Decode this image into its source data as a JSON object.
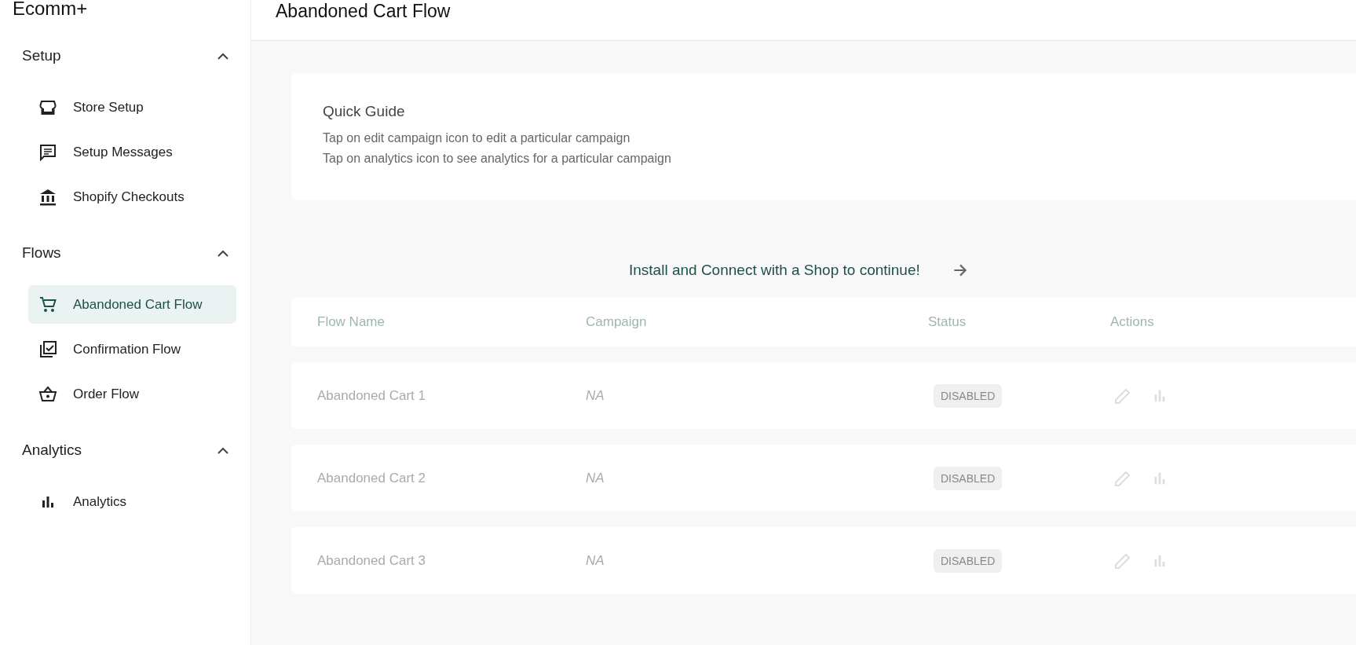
{
  "sidebar": {
    "brand": "Ecomm+",
    "sections": [
      {
        "title": "Setup",
        "expanded": true,
        "items": [
          {
            "label": "Store Setup",
            "selected": false
          },
          {
            "label": "Setup Messages",
            "selected": false
          },
          {
            "label": "Shopify Checkouts",
            "selected": false
          }
        ]
      },
      {
        "title": "Flows",
        "expanded": true,
        "items": [
          {
            "label": "Abandoned Cart Flow",
            "selected": true
          },
          {
            "label": "Confirmation Flow",
            "selected": false
          },
          {
            "label": "Order Flow",
            "selected": false
          }
        ]
      },
      {
        "title": "Analytics",
        "expanded": true,
        "items": [
          {
            "label": "Analytics",
            "selected": false
          }
        ]
      }
    ]
  },
  "header": {
    "title": "Abandoned Cart Flow"
  },
  "quick_guide": {
    "title": "Quick Guide",
    "lines": [
      "Tap on edit campaign icon to edit a particular campaign",
      "Tap on analytics icon to see analytics for a particular campaign"
    ]
  },
  "connect_prompt": {
    "label": "Install and Connect with a Shop to continue!"
  },
  "table": {
    "disabled": true,
    "columns": [
      "Flow Name",
      "Campaign",
      "Status",
      "Actions"
    ],
    "rows": [
      {
        "name": "Abandoned Cart 1",
        "campaign": "NA",
        "status": "DISABLED"
      },
      {
        "name": "Abandoned Cart 2",
        "campaign": "NA",
        "status": "DISABLED"
      },
      {
        "name": "Abandoned Cart 3",
        "campaign": "NA",
        "status": "DISABLED"
      }
    ]
  }
}
